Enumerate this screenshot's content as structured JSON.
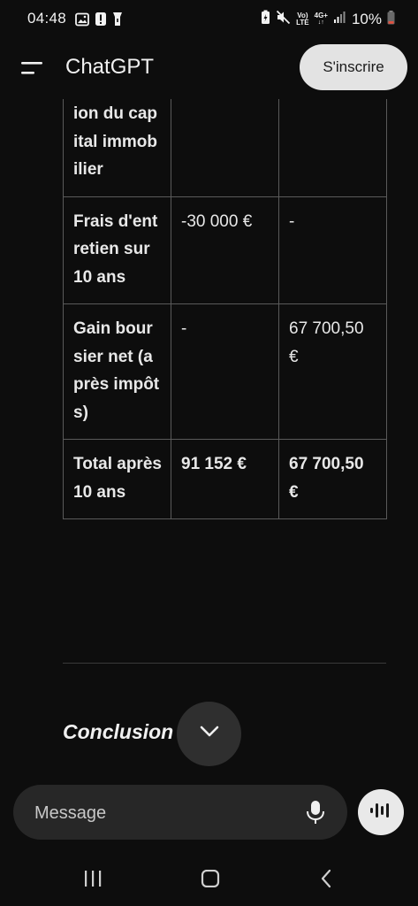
{
  "status_bar": {
    "time": "04:48",
    "network_top": "Vo)",
    "network_bottom": "LTE",
    "network_type": "4G+",
    "battery": "10%",
    "icons": [
      "image-icon",
      "alert-icon",
      "flashlight-icon",
      "battery-saver-icon",
      "mute-icon",
      "signal-icon",
      "battery-icon"
    ]
  },
  "header": {
    "title": "ChatGPT",
    "signup_label": "S'inscrire"
  },
  "table": {
    "rows": [
      {
        "label": "ion du capital immobilier",
        "col2": "",
        "col3": ""
      },
      {
        "label": "Frais d'entretien sur 10 ans",
        "col2": "-30 000 €",
        "col3": "-"
      },
      {
        "label": "Gain boursier net (après impôts)",
        "col2": "-",
        "col3": "67 700,50 €"
      },
      {
        "label": "Total après 10 ans",
        "col2": "91 152 €",
        "col3": "67 700,50 €"
      }
    ]
  },
  "conclusion_heading": "Conclusion",
  "input": {
    "placeholder": "Message"
  },
  "colors": {
    "background": "#0d0d0d",
    "signup_bg": "#e3e3e3",
    "input_bg": "#272727"
  }
}
